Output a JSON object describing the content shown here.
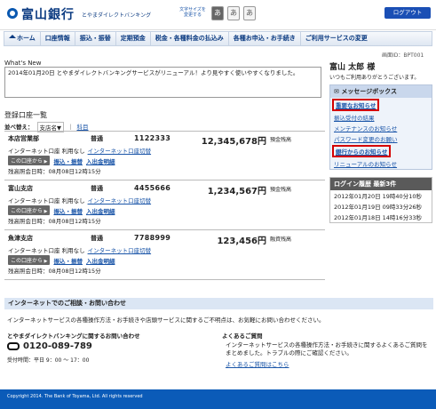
{
  "header": {
    "bank_name": "富山銀行",
    "service_name": "とやまダイレクトバンキング",
    "font_size_label": "文字サイズを変更する",
    "font_sizes": [
      "あ",
      "あ",
      "あ"
    ],
    "logout": "ログアウト"
  },
  "nav": {
    "items": [
      "ホーム",
      "口座情報",
      "振込・振替",
      "定期預金",
      "税金・各種料金の払込み",
      "各種お申込・お手続き",
      "ご利用サービスの変更"
    ]
  },
  "screen_id": "画面ID：BPT001",
  "whats_new": {
    "title": "What's New",
    "text": "2014年01月20日 とやまダイレクトバンキングサービスがリニューアル！より見やすく使いやすくなりました。"
  },
  "accounts": {
    "title": "登録口座一覧",
    "sort_label": "並べ替え：",
    "sort_value": "支店名▼",
    "sort_sep": "｜",
    "sort_link": "科目",
    "rows": [
      {
        "branch": "本店営業部",
        "type": "普通",
        "number": "1122333",
        "balance": "12,345,678円",
        "balance_label": "預金残高",
        "inet": "インターネット口座 利用なし",
        "inet_link": "インターネット口座切替",
        "tag": "この口座から",
        "link_transfer": "振込・振替",
        "link_history": "入出金明細",
        "checked": "残高照会日時：08月08日12時15分"
      },
      {
        "branch": "富山支店",
        "type": "普通",
        "number": "4455666",
        "balance": "1,234,567円",
        "balance_label": "預金残高",
        "inet": "インターネット口座 利用なし",
        "inet_link": "インターネット口座切替",
        "tag": "この口座から",
        "link_transfer": "振込・振替",
        "link_history": "入出金明細",
        "checked": "残高照会日時：08月08日12時15分"
      },
      {
        "branch": "魚津支店",
        "type": "普通",
        "number": "7788999",
        "balance": "123,456円",
        "balance_label": "融資残高",
        "inet": "インターネット口座 利用なし",
        "inet_link": "インターネット口座切替",
        "tag": "この口座から",
        "link_transfer": "振込・振替",
        "link_history": "入出金明細",
        "checked": "残高照会日時：08月08日12時15分"
      }
    ]
  },
  "sidebar": {
    "user_name": "富山 太郎 様",
    "user_greeting": "いつもご利用ありがとうございます。",
    "msg_title": "メッセージボックス",
    "messages": [
      "重要なお知らせ",
      "振込受付の結果",
      "メンテナンスのお知らせ",
      "パスワード変更のお願い",
      "銀行からのお知らせ",
      "リニューアルのお知らせ"
    ],
    "login_title": "ログイン履歴 最新3件",
    "logins": [
      "2012年01月20日 19時40分10秒",
      "2012年01月19日 09時33分26秒",
      "2012年01月18日 14時16分33秒"
    ]
  },
  "contact": {
    "bar": "インターネットでのご相談・お問い合わせ",
    "desc": "インターネットサービスの各種操作方法・お手続きや店頭サービスに関するご不明点は、お気軽にお問い合わせください。",
    "left_title": "とやまダイレクトバンキングに関するお問い合わせ",
    "phone": "0120-089-789",
    "hours": "受付時間：平日 9：00 ～ 17：00",
    "faq_title": "よくあるご質問",
    "faq_desc": "インターネットサービスの各種操作方法・お手続きに関するよくあるご質問をまとめました。トラブルの際にご確認ください。",
    "faq_link": "よくあるご質問はこちら"
  },
  "footer": "Copyright 2014. The Bank of Toyama, Ltd. All rights reserved"
}
